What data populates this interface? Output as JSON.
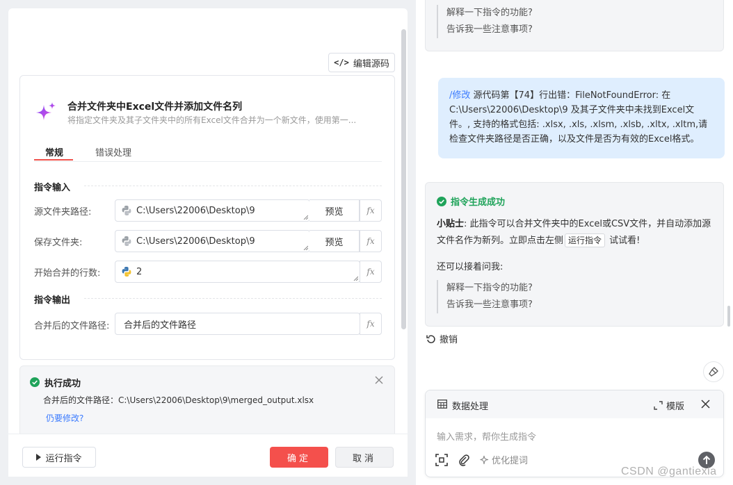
{
  "left": {
    "edit_source_label": "编辑源码",
    "command": {
      "title": "合并文件夹中Excel文件并添加文件名列",
      "description": "将指定文件夹及其子文件夹中的所有Excel文件合并为一个新文件，使用第一..."
    },
    "tabs": [
      {
        "label": "常规",
        "active": true
      },
      {
        "label": "错误处理",
        "active": false
      }
    ],
    "input_section_title": "指令输入",
    "output_section_title": "指令输出",
    "fields": [
      {
        "label": "源文件夹路径:",
        "value": "C:\\Users\\22006\\Desktop\\9",
        "action": "预览",
        "fx": "fx"
      },
      {
        "label": "保存文件夹:",
        "value": "C:\\Users\\22006\\Desktop\\9",
        "action": "预览",
        "fx": "fx"
      },
      {
        "label": "开始合并的行数:",
        "value": "2",
        "fx": "fx"
      }
    ],
    "output_field": {
      "label": "合并后的文件路径:",
      "value": "合并后的文件路径",
      "fx": "fx"
    },
    "result": {
      "title": "执行成功",
      "path": "合并后的文件路径：C:\\Users\\22006\\Desktop\\9\\merged_output.xlsx",
      "link": "仍要修改?"
    },
    "footer": {
      "run_label": "运行指令",
      "ok_label": "确定",
      "cancel_label": "取消"
    }
  },
  "right": {
    "top_suggestions": [
      "解释一下指令的功能?",
      "告诉我一些注意事项?"
    ],
    "user_message": {
      "tag": "/修改",
      "text": " 源代码第【74】行出错：FileNotFoundError: 在 C:\\Users\\22006\\Desktop\\9 及其子文件夹中未找到Excel文件。, 支持的格式包括: .xlsx, .xls, .xlsm, .xlsb, .xltx, .xltm,请检查文件夹路径是否正确，以及文件是否为有效的Excel格式。"
    },
    "reply": {
      "status": "指令生成成功",
      "tip_label": "小贴士",
      "tip_text_1": ": 此指令可以合并文件夹中的Excel或CSV文件，并自动添加源文件名作为新列。立即点击左侧",
      "tip_button": "运行指令",
      "tip_text_2": " 试试看!",
      "ask_more": "还可以接着问我:",
      "suggestions": [
        "解释一下指令的功能?",
        "告诉我一些注意事项?"
      ]
    },
    "undo_label": "撤销",
    "input": {
      "mode_label": "数据处理",
      "template_label": "模版",
      "placeholder": "输入需求，帮你生成指令",
      "optimize_label": "优化提词"
    }
  },
  "watermark": "CSDN @gantiexia"
}
